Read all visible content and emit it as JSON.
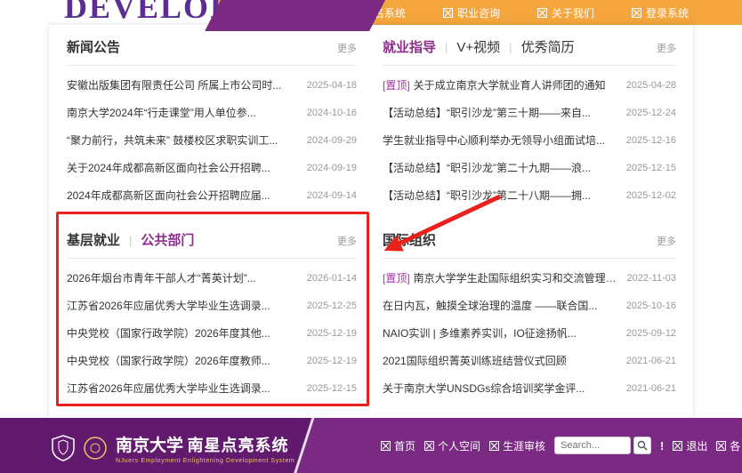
{
  "topbar": {
    "banner_text": "DEVELOPMENT",
    "nav": [
      {
        "label": "报名系统"
      },
      {
        "label": "职业咨询"
      },
      {
        "label": "关于我们"
      },
      {
        "label": "登录系统"
      }
    ]
  },
  "panels": {
    "news": {
      "title": "新闻公告",
      "more": "更多",
      "items": [
        {
          "text": "安徽出版集团有限责任公司 所属上市公司时...",
          "date": "2025-04-18"
        },
        {
          "text": "南京大学2024年“行走课堂”用人单位参...",
          "date": "2024-10-16"
        },
        {
          "text": "“聚力前行，共筑未来” 鼓楼校区求职实训工...",
          "date": "2024-09-29"
        },
        {
          "text": "关于2024年成都高新区面向社会公开招聘...",
          "date": "2024-09-19"
        },
        {
          "text": "2024年成都高新区面向社会公开招聘应届...",
          "date": "2024-09-14"
        }
      ]
    },
    "guidance": {
      "tabs": [
        "就业指导",
        "V+视频",
        "优秀简历"
      ],
      "more": "更多",
      "items": [
        {
          "tag": "[置顶]",
          "text": "关于成立南京大学就业育人讲师团的通知",
          "date": "2025-04-28"
        },
        {
          "text": "【活动总结】“职引沙龙”第三十期——来自...",
          "date": "2025-12-24"
        },
        {
          "text": "学生就业指导中心顺利举办无领导小组面试培...",
          "date": "2025-12-16"
        },
        {
          "text": "【活动总结】“职引沙龙”第二十九期——浪...",
          "date": "2025-12-15"
        },
        {
          "text": "【活动总结】“职引沙龙”第二十八期——拥...",
          "date": "2025-12-02"
        }
      ]
    },
    "grassroots": {
      "tabs": [
        "基层就业",
        "公共部门"
      ],
      "more": "更多",
      "items": [
        {
          "text": "2026年烟台市青年干部人才“菁英计划”...",
          "date": "2026-01-14"
        },
        {
          "text": "江苏省2026年应届优秀大学毕业生选调录...",
          "date": "2025-12-25"
        },
        {
          "text": "中央党校（国家行政学院）2026年度其他...",
          "date": "2025-12-19"
        },
        {
          "text": "中央党校（国家行政学院）2026年度教师...",
          "date": "2025-12-19"
        },
        {
          "text": "江苏省2026年应届优秀大学毕业生选调录...",
          "date": "2025-12-15"
        }
      ]
    },
    "international": {
      "title": "国际组织",
      "more": "更多",
      "items": [
        {
          "tag": "[置顶]",
          "text": "南京大学学生赴国际组织实习和交流管理办...",
          "date": "2022-11-03"
        },
        {
          "text": "在日内瓦，触摸全球治理的温度 ——联合国...",
          "date": "2025-10-16"
        },
        {
          "text": "NAIO实训 | 多维素养实训，IO征途扬帆...",
          "date": "2025-09-12"
        },
        {
          "text": "2021国际组织菁英训练班结营仪式回顾",
          "date": "2021-06-21"
        },
        {
          "text": "关于南京大学UNSDGs综合培训奖学金评...",
          "date": "2021-06-21"
        }
      ]
    }
  },
  "footer": {
    "cn_title": "南京大学",
    "cn_system": "南星点亮系统",
    "en_subtitle": "NJuers Employment Enlightening Development System",
    "nav": [
      {
        "label": "首页"
      },
      {
        "label": "个人空间"
      },
      {
        "label": "生涯审核"
      }
    ],
    "search_placeholder": "Search...",
    "alert": "!",
    "logout": "退出",
    "partial_last": "各"
  },
  "colors": {
    "brand_purple": "#7b2a83",
    "footer_dark_purple": "#611a6d",
    "topbar_orange": "#f4a53b",
    "highlight_red": "#e8221c",
    "gold": "#e9c36a"
  }
}
